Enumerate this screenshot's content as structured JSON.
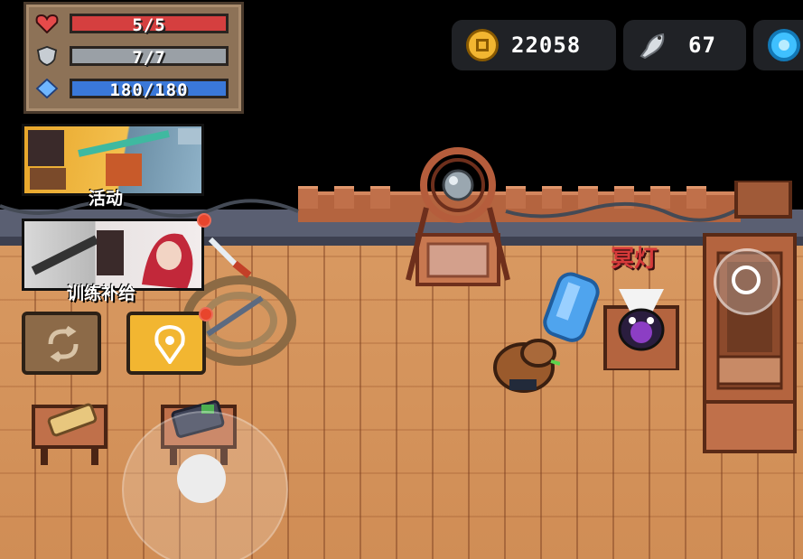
{
  "hud": {
    "hp": {
      "value": "5/5",
      "icon": "heart-icon",
      "color": "#d53f3f"
    },
    "armor": {
      "value": "7/7",
      "icon": "shield-icon",
      "color": "#9aa0a6"
    },
    "energy": {
      "value": "180/180",
      "icon": "diamond-icon",
      "color": "#3a78d9"
    }
  },
  "currency": {
    "gold": {
      "value": "22058",
      "icon": "gold-coin-icon"
    },
    "fish": {
      "value": "67",
      "icon": "fish-icon"
    },
    "gem": {
      "icon": "gem-icon"
    }
  },
  "menu": {
    "event_label": "活动",
    "training_label": "训练补给"
  },
  "npc": {
    "name": "冥灯"
  },
  "colors": {
    "floor": "#d99a62",
    "panel": "#8d7257",
    "pill": "#202226",
    "accent_yellow": "#f2b631",
    "name_red": "#d63a3a"
  }
}
